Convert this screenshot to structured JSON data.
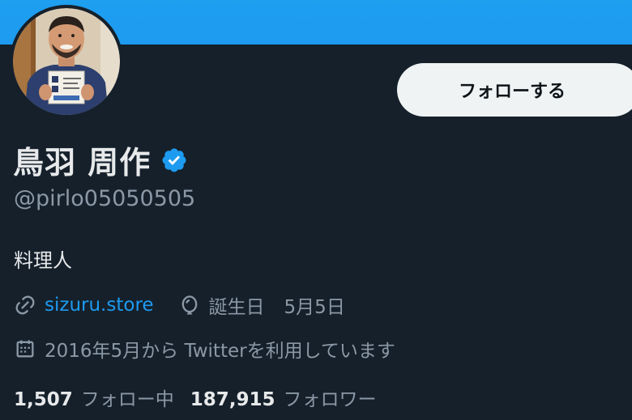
{
  "profile": {
    "display_name": "鳥羽 周作",
    "handle": "@pirlo05050505",
    "bio": "料理人",
    "website": "sizuru.store",
    "birthday_label": "誕生日",
    "birthday_value": "5月5日",
    "joined": "2016年5月から Twitterを利用しています",
    "verified": true
  },
  "actions": {
    "follow_label": "フォローする"
  },
  "stats": {
    "following_count": "1,507",
    "following_label": "フォロー中",
    "followers_count": "187,915",
    "followers_label": "フォロワー"
  },
  "icons": {
    "link": "link-icon",
    "birthday": "balloon-icon",
    "joined": "calendar-icon",
    "verified": "verified-badge-icon"
  },
  "colors": {
    "background": "#15202b",
    "banner": "#1d9bf0",
    "accent": "#1d9bf0",
    "text_primary": "#e7e9ea",
    "text_secondary": "#8b98a5",
    "button_bg": "#eff3f4"
  }
}
